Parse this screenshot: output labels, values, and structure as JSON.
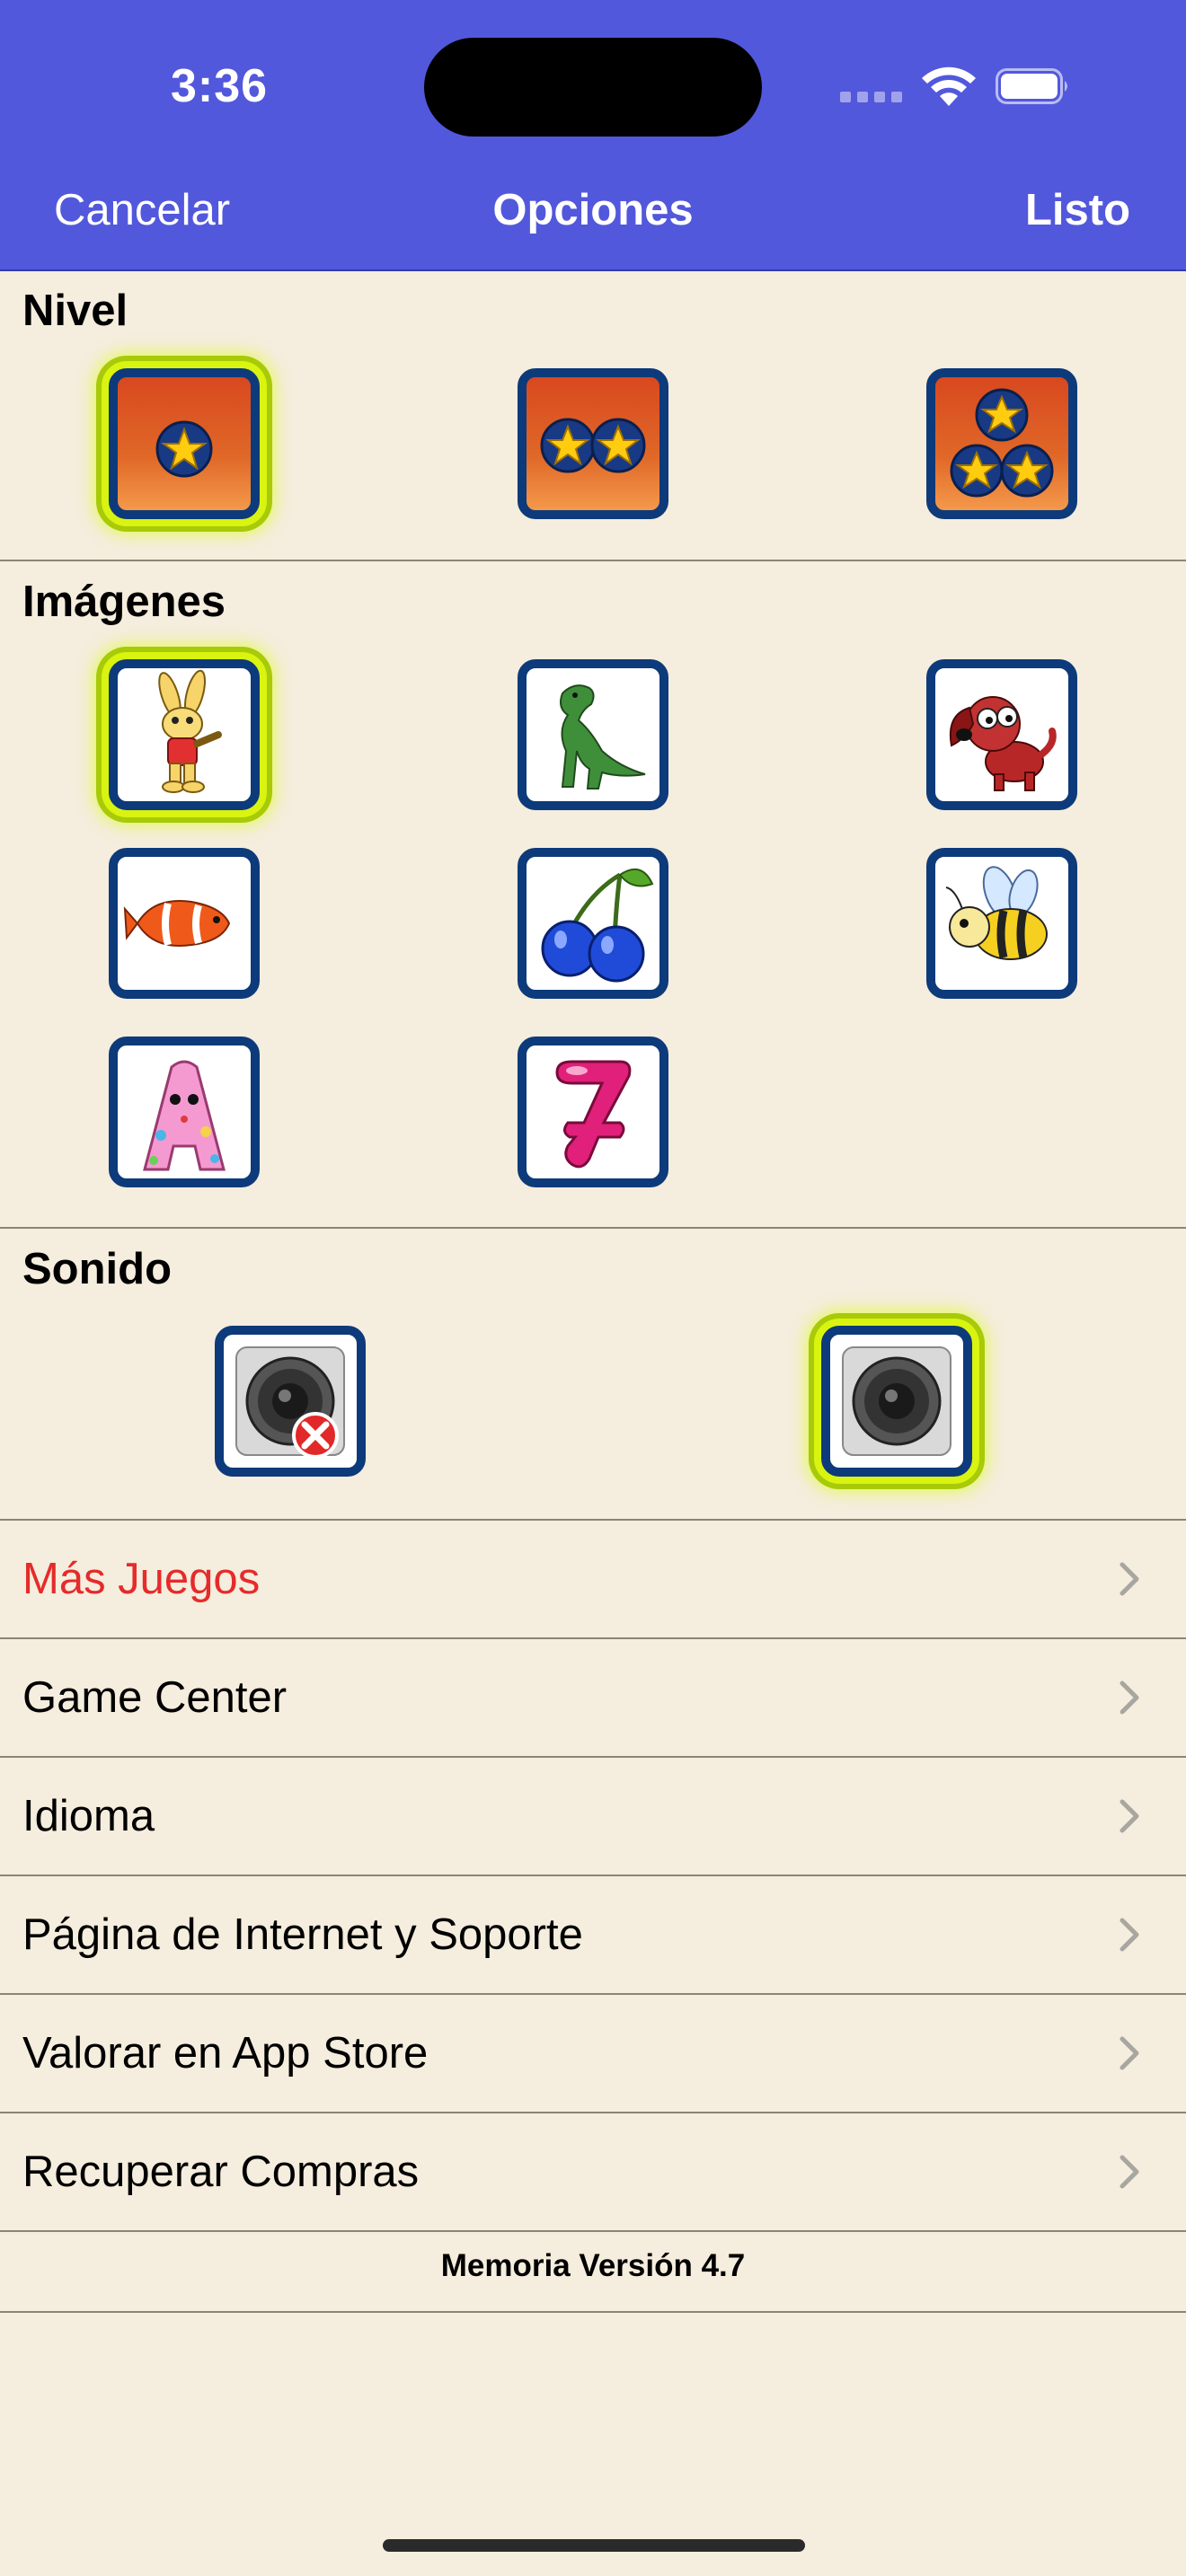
{
  "status_bar": {
    "time": "3:36"
  },
  "nav": {
    "cancel": "Cancelar",
    "title": "Opciones",
    "done": "Listo"
  },
  "sections": {
    "level": {
      "title": "Nivel",
      "options": [
        {
          "stars": 1,
          "selected": true
        },
        {
          "stars": 2,
          "selected": false
        },
        {
          "stars": 3,
          "selected": false
        }
      ]
    },
    "images": {
      "title": "Imágenes",
      "options": [
        "rabbit-icon",
        "dinosaur-icon",
        "dog-icon",
        "fish-icon",
        "cherries-icon",
        "bee-icon",
        "letter-a-icon",
        "number-7-icon"
      ],
      "selected_index": 0
    },
    "sound": {
      "title": "Sonido",
      "options": [
        "sound-off-icon",
        "sound-on-icon"
      ],
      "selected_index": 1
    }
  },
  "menu": {
    "items": [
      {
        "label": "Más Juegos",
        "color": "#e52b2b"
      },
      {
        "label": "Game Center"
      },
      {
        "label": "Idioma"
      },
      {
        "label": "Página de Internet y Soporte"
      },
      {
        "label": "Valorar en App Store"
      },
      {
        "label": "Recuperar Compras"
      }
    ]
  },
  "footer": {
    "version": "Memoria Versión 4.7"
  },
  "colors": {
    "header": "#5258dc",
    "background": "#f5eddd",
    "tile_border": "#0d3a7a",
    "selection": "#d8f410",
    "accent_red": "#e52b2b"
  }
}
